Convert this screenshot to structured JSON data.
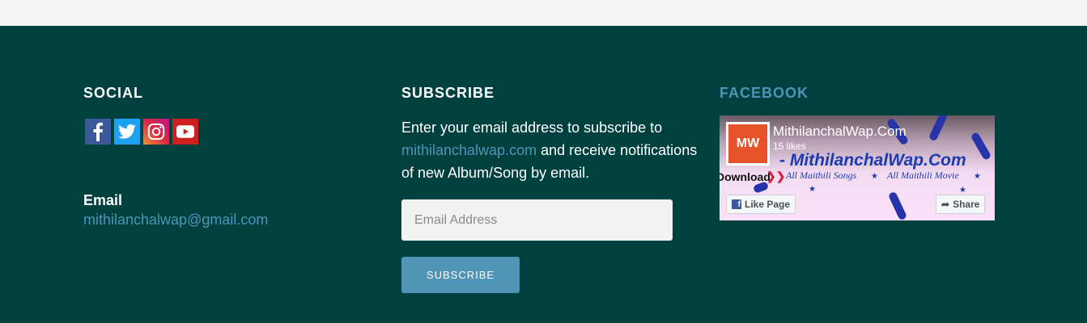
{
  "social": {
    "heading": "SOCIAL",
    "icons": [
      "facebook-icon",
      "twitter-icon",
      "instagram-icon",
      "youtube-icon"
    ],
    "email_label": "Email",
    "email": "mithilanchalwap@gmail.com"
  },
  "subscribe": {
    "heading": "SUBSCRIBE",
    "text_before": "Enter your email address to subscribe to",
    "link": "mithilanchalwap.com",
    "text_after": "and receive notifications of new Album/Song by email.",
    "placeholder": "Email Address",
    "button": "SUBSCRIBE"
  },
  "facebook": {
    "heading": "FACEBOOK",
    "logo": "MW",
    "page_name": "MithilanchalWap.Com",
    "likes": "15 likes",
    "banner": "- MithilanchalWap.Com",
    "download": "Download",
    "songs": "All Maithili Songs",
    "movie": "All Maithili Movie",
    "like_button": "Like Page",
    "share_button": "Share"
  },
  "colors": {
    "background": "#00403f",
    "accent": "#4f95b7",
    "top_bar": "#f4f4f4"
  }
}
